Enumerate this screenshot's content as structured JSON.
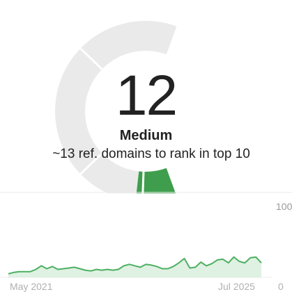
{
  "keyword_difficulty": {
    "score": "12",
    "score_value": 12,
    "level": "Medium",
    "hint": "~13 ref. domains to rank in top 10",
    "fill_color": "#3f9e4d",
    "track_color": "#eaeaea"
  },
  "chart_data": {
    "type": "area",
    "x_start_label": "May 2021",
    "x_end_label": "Jul 2025",
    "y_max_label": "100",
    "right_axis_label": "0",
    "ylim": [
      0,
      100
    ],
    "line_color": "#4caf61",
    "fill_color": "#dff1e2",
    "values": [
      3,
      5,
      6,
      6,
      6,
      9,
      14,
      10,
      13,
      9,
      10,
      11,
      12,
      10,
      8,
      7,
      9,
      8,
      9,
      8,
      9,
      14,
      16,
      14,
      12,
      16,
      15,
      13,
      10,
      10,
      13,
      18,
      24,
      11,
      12,
      19,
      14,
      17,
      22,
      23,
      18,
      26,
      20,
      18,
      25,
      26,
      18
    ]
  }
}
